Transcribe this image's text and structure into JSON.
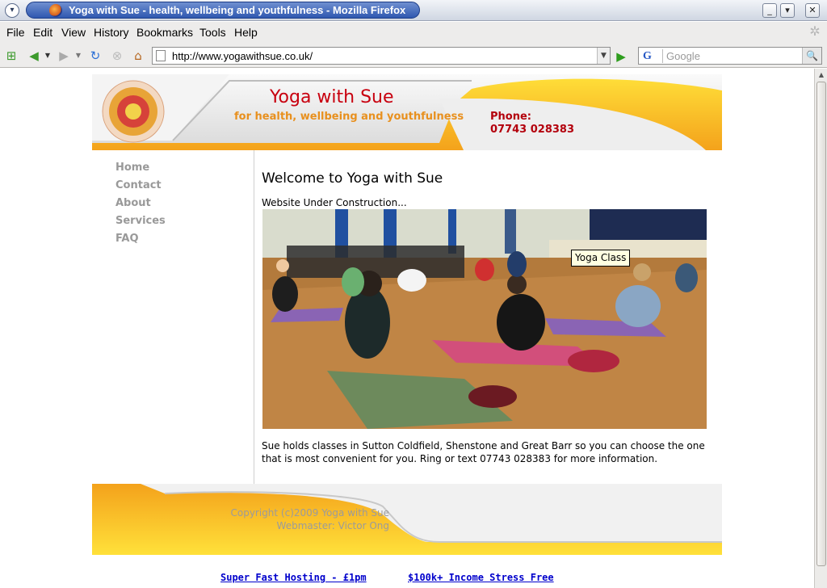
{
  "window": {
    "title": "Yoga with Sue - health, wellbeing and youthfulness - Mozilla Firefox"
  },
  "menu": {
    "file": "File",
    "edit": "Edit",
    "view": "View",
    "history": "History",
    "bookmarks": "Bookmarks",
    "tools": "Tools",
    "help": "Help"
  },
  "toolbar": {
    "url": "http://www.yogawithsue.co.uk/",
    "search_engine": "G",
    "search_placeholder": "Google"
  },
  "site": {
    "title": "Yoga with Sue",
    "subtitle": "for health, wellbeing and youthfulness",
    "phone_label": "Phone:",
    "phone_number": "07743 028383"
  },
  "nav": [
    "Home",
    "Contact",
    "About",
    "Services",
    "FAQ"
  ],
  "content": {
    "heading": "Welcome to Yoga with Sue",
    "construction": "Website Under Construction...",
    "image_tooltip": "Yoga Class",
    "paragraph": "Sue holds classes in Sutton Coldfield, Shenstone and Great Barr so you can choose the one that is most convenient for you. Ring or text 07743 028383 for more information."
  },
  "footer": {
    "copyright": "Copyright (c)2009 Yoga with Sue",
    "webmaster": "Webmaster: Victor Ong"
  },
  "ads": [
    {
      "title": "Super Fast Hosting - £1pm",
      "desc": ""
    },
    {
      "title": "$100k+ Income Stress Free",
      "desc": ""
    }
  ],
  "colors": {
    "brand_red": "#c8000f",
    "brand_orange": "#e8901e",
    "header_yellow": "#ffd400"
  }
}
